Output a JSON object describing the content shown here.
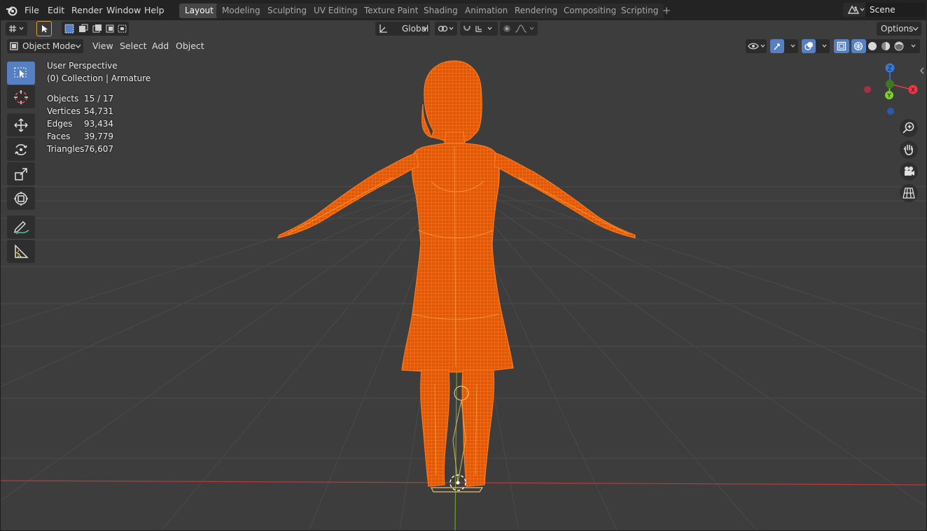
{
  "menu": {
    "items": [
      "File",
      "Edit",
      "Render",
      "Window",
      "Help"
    ]
  },
  "workspaces": {
    "tabs": [
      "Layout",
      "Modeling",
      "Sculpting",
      "UV Editing",
      "Texture Paint",
      "Shading",
      "Animation",
      "Rendering",
      "Compositing",
      "Scripting"
    ],
    "active": "Layout",
    "add_label": "+"
  },
  "scene": {
    "name": "Scene"
  },
  "tool_header": {
    "transform_orientation": "Global",
    "options_label": "Options"
  },
  "viewport_header": {
    "mode": "Object Mode",
    "menus": [
      "View",
      "Select",
      "Add",
      "Object"
    ]
  },
  "overlay": {
    "view_name": "User Perspective",
    "collection": "(0) Collection | Armature",
    "stats": [
      {
        "label": "Objects",
        "value": "15 / 17"
      },
      {
        "label": "Vertices",
        "value": "54,731"
      },
      {
        "label": "Edges",
        "value": "93,434"
      },
      {
        "label": "Faces",
        "value": "39,779"
      },
      {
        "label": "Triangles",
        "value": "76,607"
      }
    ]
  },
  "gizmo": {
    "z_label": "Z",
    "y_label": "Y",
    "x_label": "X"
  },
  "toolbar_tools": [
    "select-box",
    "cursor",
    "move",
    "rotate",
    "scale",
    "transform",
    "annotate",
    "measure"
  ],
  "colors": {
    "selection": "#ff6a10",
    "active_tool": "#5680c2",
    "axis_x": "#f03548",
    "axis_y": "#7fd02b",
    "axis_z": "#3579e0",
    "viewport_bg": "#3d3d3d"
  }
}
